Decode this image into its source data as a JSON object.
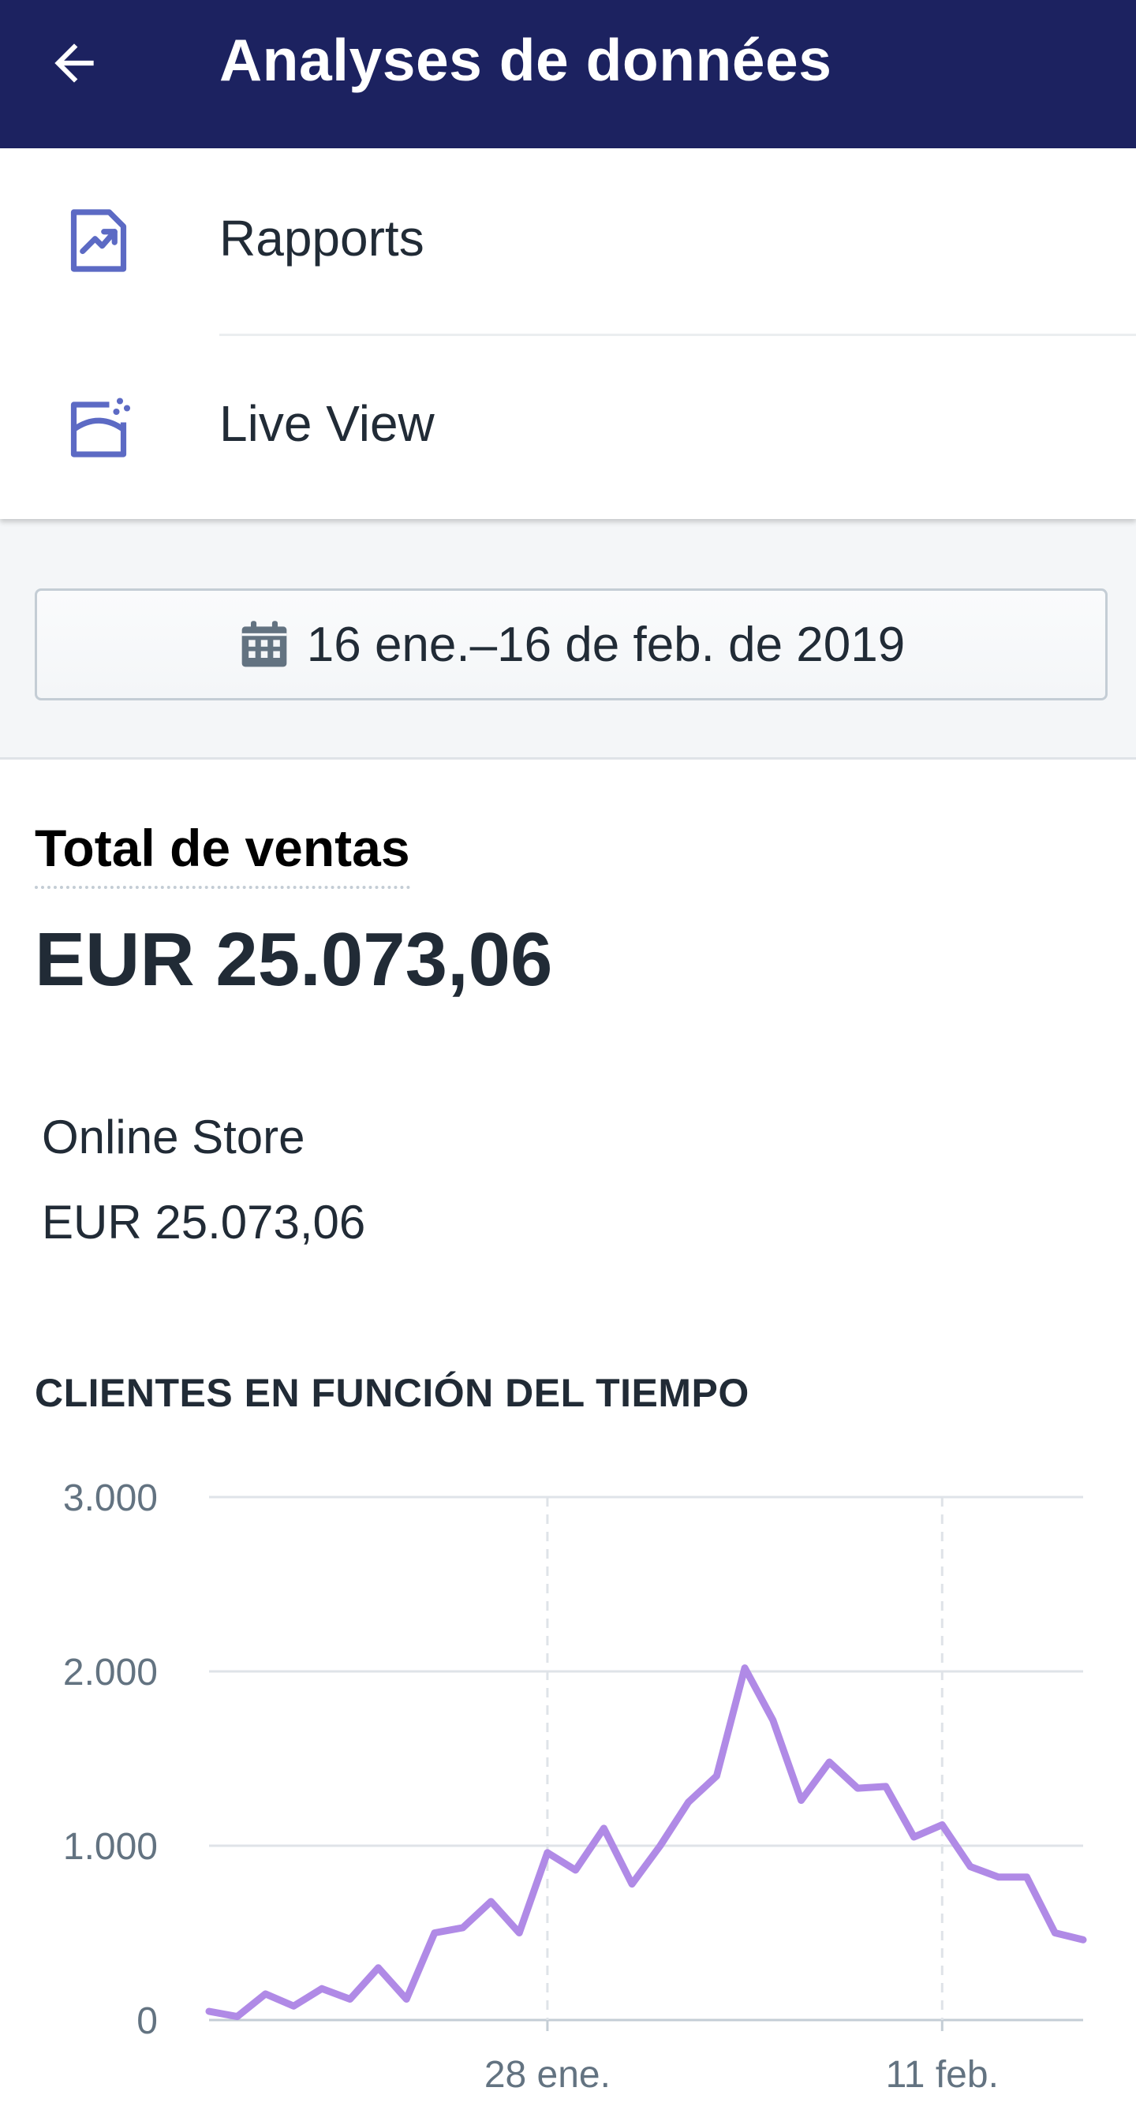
{
  "appbar": {
    "title": "Analyses de données",
    "back_icon": "arrow-left-icon"
  },
  "menu": {
    "items": [
      {
        "label": "Rapports",
        "icon": "reports-icon"
      },
      {
        "label": "Live View",
        "icon": "live-view-icon"
      }
    ]
  },
  "date_range": {
    "label": "16 ene.–16 de feb. de 2019",
    "icon": "calendar-icon"
  },
  "sales": {
    "title": "Total de ventas",
    "total": "EUR 25.073,06",
    "channel": {
      "name": "Online Store",
      "value": "EUR 25.073,06"
    }
  },
  "colors": {
    "appbar": "#1c2260",
    "icon_accent": "#5c6ac4",
    "line": "#b08ae6"
  },
  "chart_data": {
    "type": "line",
    "title": "CLIENTES EN FUNCIÓN DEL TIEMPO",
    "x": [
      "16 ene.",
      "17 ene.",
      "18 ene.",
      "19 ene.",
      "20 ene.",
      "21 ene.",
      "22 ene.",
      "23 ene.",
      "24 ene.",
      "25 ene.",
      "26 ene.",
      "27 ene.",
      "28 ene.",
      "29 ene.",
      "30 ene.",
      "31 ene.",
      "1 feb.",
      "2 feb.",
      "3 feb.",
      "4 feb.",
      "5 feb.",
      "6 feb.",
      "7 feb.",
      "8 feb.",
      "9 feb.",
      "10 feb.",
      "11 feb.",
      "12 feb.",
      "13 feb.",
      "14 feb.",
      "15 feb.",
      "16 feb."
    ],
    "series": [
      {
        "values": [
          50,
          20,
          150,
          80,
          180,
          120,
          300,
          120,
          500,
          530,
          680,
          500,
          960,
          860,
          1100,
          780,
          1000,
          1250,
          1400,
          2020,
          1720,
          1260,
          1480,
          1330,
          1340,
          1050,
          1120,
          880,
          820,
          820,
          500,
          460
        ]
      }
    ],
    "x_tick_labels": [
      "28 ene.",
      "11 feb."
    ],
    "y_tick_labels": [
      "0",
      "1.000",
      "2.000",
      "3.000"
    ],
    "ylim": [
      0,
      3000
    ],
    "grid": true,
    "xlabel": "",
    "ylabel": ""
  }
}
